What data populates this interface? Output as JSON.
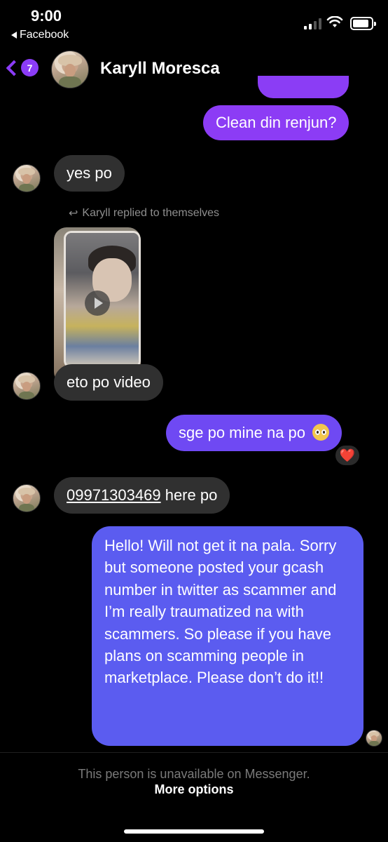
{
  "status_bar": {
    "time": "9:00",
    "back_app": "Facebook"
  },
  "header": {
    "unread_count": "7",
    "contact_name": "Karyll Moresca"
  },
  "messages": [
    {
      "from": "me",
      "text": "Clean din renjun?"
    },
    {
      "from": "them",
      "text": "yes po"
    },
    {
      "from": "them",
      "reply_note": "Karyll replied to themselves",
      "attachment": "video"
    },
    {
      "from": "them",
      "text": "eto po video"
    },
    {
      "from": "me",
      "text": "sge po mine na po",
      "emoji": "pleading-face",
      "reaction": "❤️"
    },
    {
      "from": "them",
      "number": "09971303469",
      "text_after": " here po"
    },
    {
      "from": "me",
      "text": "Hello! Will not get it na pala. Sorry but someone posted your gcash number in twitter as scammer and I’m really traumatized na with scammers. So please if you have plans on scamming people in marketplace. Please don’t do it!!"
    }
  ],
  "footer": {
    "unavailable_text": "This person is unavailable on Messenger.",
    "more_options": "More options"
  },
  "colors": {
    "accent": "#8b3cf7",
    "incoming_bubble": "#303030",
    "outgoing_top": "#8c3cf5",
    "outgoing_mid": "#6f49f3",
    "outgoing_bottom": "#5b5cf0"
  }
}
